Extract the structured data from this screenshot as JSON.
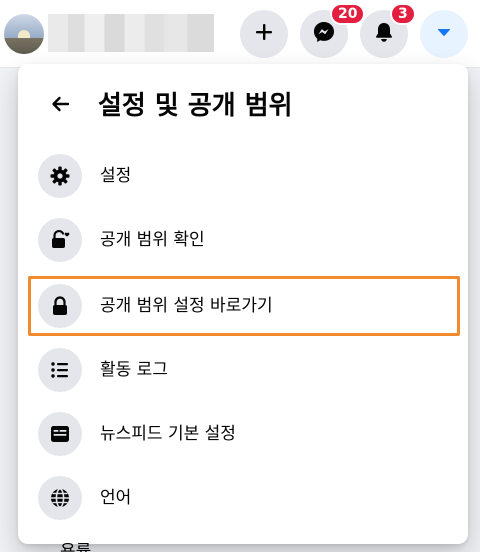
{
  "topbar": {
    "avatar_icon": "profile-photo",
    "name_redacted": true,
    "create_button_icon": "plus-icon",
    "messenger": {
      "icon": "messenger-icon",
      "badge": "20"
    },
    "notifications": {
      "icon": "bell-icon",
      "badge": "3"
    },
    "account_menu_icon": "caret-down-icon",
    "accent_color": "#1877f2",
    "badge_color": "#e41e3f"
  },
  "panel": {
    "title": "설정 및 공개 범위",
    "back_icon": "arrow-left-icon",
    "items": [
      {
        "label": "설정",
        "icon": "gear-icon"
      },
      {
        "label": "공개 범위 확인",
        "icon": "lock-heart-icon"
      },
      {
        "label": "공개 범위 설정 바로가기",
        "icon": "lock-icon",
        "highlighted": true
      },
      {
        "label": "활동 로그",
        "icon": "list-icon"
      },
      {
        "label": "뉴스피드 기본 설정",
        "icon": "feed-icon"
      },
      {
        "label": "언어",
        "icon": "globe-icon"
      }
    ],
    "highlight_color": "#f28a2e"
  },
  "underlay": {
    "text": "용률"
  }
}
